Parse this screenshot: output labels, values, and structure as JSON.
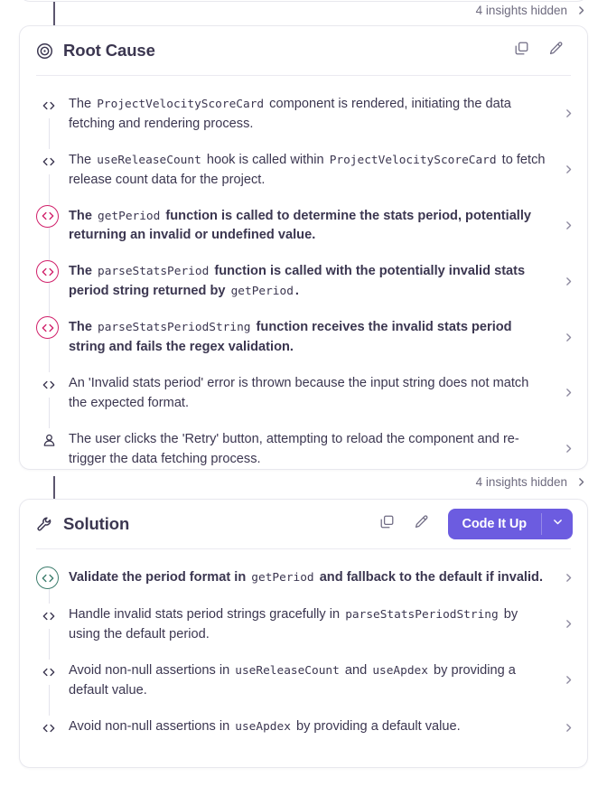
{
  "theme": {
    "accent_purple": "#6c5ce0",
    "accent_pink": "#d1216b",
    "accent_green": "#3c7d6d",
    "text_primary": "#3b3650",
    "text_muted": "#6e6b7f",
    "card_border": "#e8e8ee",
    "background": "#ffffff"
  },
  "hidden_insights_top": {
    "label": "4 insights hidden",
    "chevron_icon": "chevron-right-icon"
  },
  "hidden_insights_mid": {
    "label": "4 insights hidden",
    "chevron_icon": "chevron-right-icon"
  },
  "root_cause": {
    "title": "Root Cause",
    "title_icon": "target-icon",
    "actions": {
      "copy_icon": "copy-icon",
      "edit_icon": "pencil-icon"
    },
    "items": [
      {
        "icon": "code-icon",
        "ringed": false,
        "accent": "none",
        "emphasis": false,
        "html": "The <code>ProjectVelocityScoreCard</code> component is rendered, initiating the data fetching and rendering process.",
        "chevron_icon": "chevron-right-icon"
      },
      {
        "icon": "code-icon",
        "ringed": false,
        "accent": "none",
        "emphasis": false,
        "html": "The <code>useReleaseCount</code> hook is called within <code>ProjectVelocityScoreCard</code> to fetch release count data for the project.",
        "chevron_icon": "chevron-right-icon"
      },
      {
        "icon": "code-icon",
        "ringed": true,
        "accent": "pink",
        "emphasis": true,
        "html": "The <code>getPeriod</code> function is called to determine the stats period, potentially returning an invalid or undefined value.",
        "chevron_icon": "chevron-right-icon"
      },
      {
        "icon": "code-icon",
        "ringed": true,
        "accent": "pink",
        "emphasis": true,
        "html": "The <code>parseStatsPeriod</code> function is called with the potentially invalid stats period string returned by <code>getPeriod</code>.",
        "chevron_icon": "chevron-right-icon"
      },
      {
        "icon": "code-icon",
        "ringed": true,
        "accent": "pink",
        "emphasis": true,
        "html": "The <code>parseStatsPeriodString</code> function receives the invalid stats period string and fails the regex validation.",
        "chevron_icon": "chevron-right-icon"
      },
      {
        "icon": "code-icon",
        "ringed": false,
        "accent": "none",
        "emphasis": false,
        "html": "An 'Invalid stats period' error is thrown because the input string does not match the expected format.",
        "chevron_icon": "chevron-right-icon"
      },
      {
        "icon": "user-icon",
        "ringed": false,
        "accent": "none",
        "emphasis": false,
        "html": "The user clicks the 'Retry' button, attempting to reload the component and re-trigger the data fetching process.",
        "chevron_icon": "chevron-right-icon"
      }
    ]
  },
  "solution": {
    "title": "Solution",
    "title_icon": "wrench-icon",
    "actions": {
      "copy_icon": "copy-icon",
      "edit_icon": "pencil-icon"
    },
    "primary_button": {
      "label": "Code It Up",
      "caret_icon": "chevron-down-icon"
    },
    "items": [
      {
        "icon": "code-icon",
        "ringed": true,
        "accent": "green",
        "emphasis": true,
        "html": "Validate the period format in <code>getPeriod</code> and fallback to the default if invalid.",
        "chevron_icon": "chevron-right-icon"
      },
      {
        "icon": "code-icon",
        "ringed": false,
        "accent": "none",
        "emphasis": false,
        "html": "Handle invalid stats period strings gracefully in <code>parseStatsPeriodString</code> by using the default period.",
        "chevron_icon": "chevron-right-icon"
      },
      {
        "icon": "code-icon",
        "ringed": false,
        "accent": "none",
        "emphasis": false,
        "html": "Avoid non-null assertions in <code>useReleaseCount</code> and <code>useApdex</code> by providing a default value.",
        "chevron_icon": "chevron-right-icon"
      },
      {
        "icon": "code-icon",
        "ringed": false,
        "accent": "none",
        "emphasis": false,
        "html": "Avoid non-null assertions in <code>useApdex</code> by providing a default value.",
        "chevron_icon": "chevron-right-icon"
      }
    ]
  }
}
